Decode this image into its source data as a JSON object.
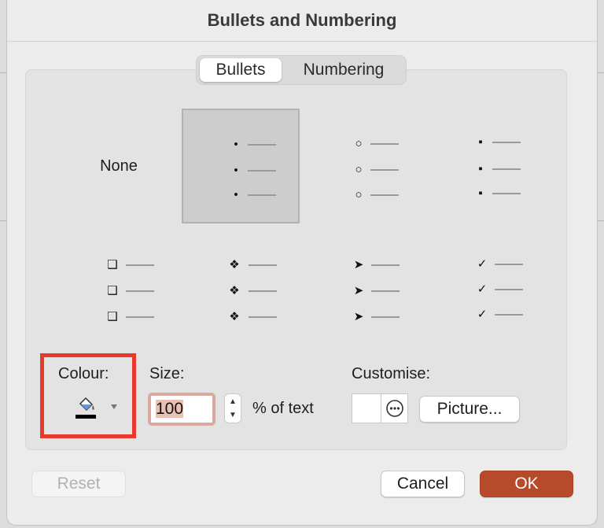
{
  "dialog": {
    "title": "Bullets and Numbering"
  },
  "tabs": [
    {
      "label": "Bullets",
      "active": true
    },
    {
      "label": "Numbering",
      "active": false
    }
  ],
  "bullet_styles": [
    {
      "id": "none",
      "label": "None",
      "glyph": "",
      "selected": false
    },
    {
      "id": "filled-dot",
      "glyph": "•",
      "selected": true
    },
    {
      "id": "hollow-circle",
      "glyph": "○",
      "selected": false
    },
    {
      "id": "filled-square",
      "glyph": "▪",
      "selected": false
    },
    {
      "id": "shadowed-square",
      "glyph": "❑",
      "selected": false
    },
    {
      "id": "diamond",
      "glyph": "❖",
      "selected": false
    },
    {
      "id": "arrowhead",
      "glyph": "➤",
      "selected": false
    },
    {
      "id": "checkmark",
      "glyph": "✓",
      "selected": false
    }
  ],
  "colour": {
    "label": "Colour:",
    "value_color": "#000000",
    "icon": "paint-bucket-icon"
  },
  "size": {
    "label": "Size:",
    "value": "100",
    "unit": "% of text"
  },
  "customise": {
    "label": "Customise:",
    "picture_label": "Picture..."
  },
  "footer": {
    "reset_label": "Reset",
    "cancel_label": "Cancel",
    "ok_label": "OK"
  },
  "colors": {
    "accent": "#b64a2a",
    "highlight": "#e8392a",
    "selection": "#cdcdcd"
  }
}
